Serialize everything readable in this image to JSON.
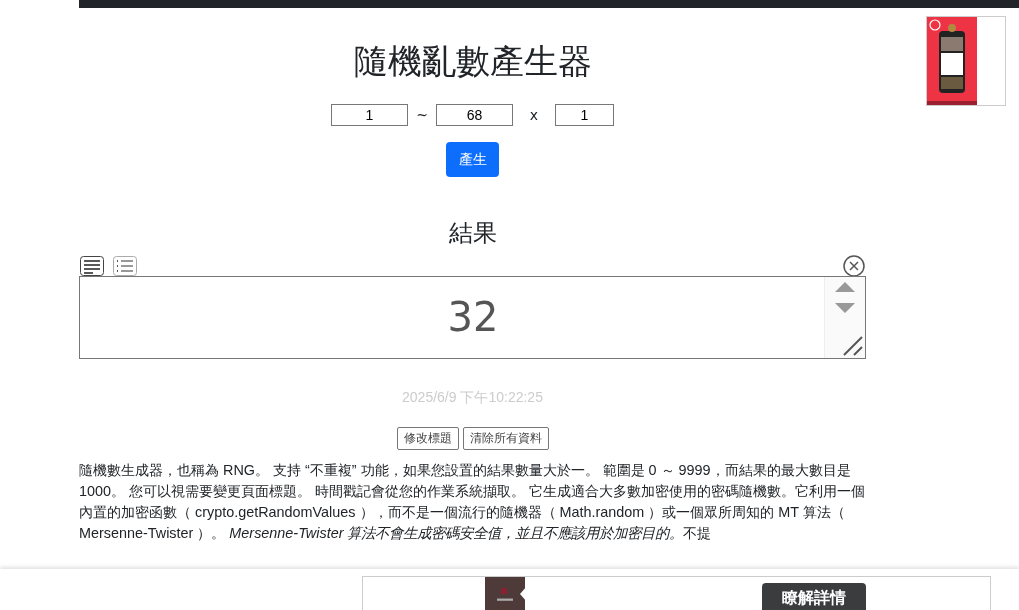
{
  "title": "隨機亂數產生器",
  "range": {
    "min": "1",
    "separator": "~",
    "max": "68",
    "times_label": "x",
    "count": "1"
  },
  "generate_button": "產生",
  "result_heading": "結果",
  "view_modes": [
    {
      "kind": "text",
      "selected": true
    },
    {
      "kind": "list",
      "selected": false
    }
  ],
  "result": {
    "value": "32"
  },
  "timestamp": "2025/6/9 下午10:22:25",
  "actions": [
    "修改標題",
    "清除所有資料"
  ],
  "description": [
    {
      "text": "隨機數生成器，也稱為 RNG。 支持 “不重複” 功能，如果您設置的結果數量大於一。 範圍是 0 ～ 9999，而結果的最大數目是 1000。 您可以視需要變更頁面標題。 時間戳記會從您的作業系統擷取。 它生成適合大多數加密使用的密碼隨機數。它利用一個內置的加密函數（ crypto.getRandomValues ），而不是一個流行的隨機器（ Math.random ）或一個眾所周知的 MT 算法（ Mersenne-Twister ）。 ",
      "italic": false
    },
    {
      "text": "Mersenne-Twister 算法不會生成密碼安全值，並且不應該用於加密目的。",
      "italic": true
    },
    {
      "text": "不提",
      "italic": false
    }
  ],
  "bottom_ad": {
    "button": "瞭解詳情"
  }
}
